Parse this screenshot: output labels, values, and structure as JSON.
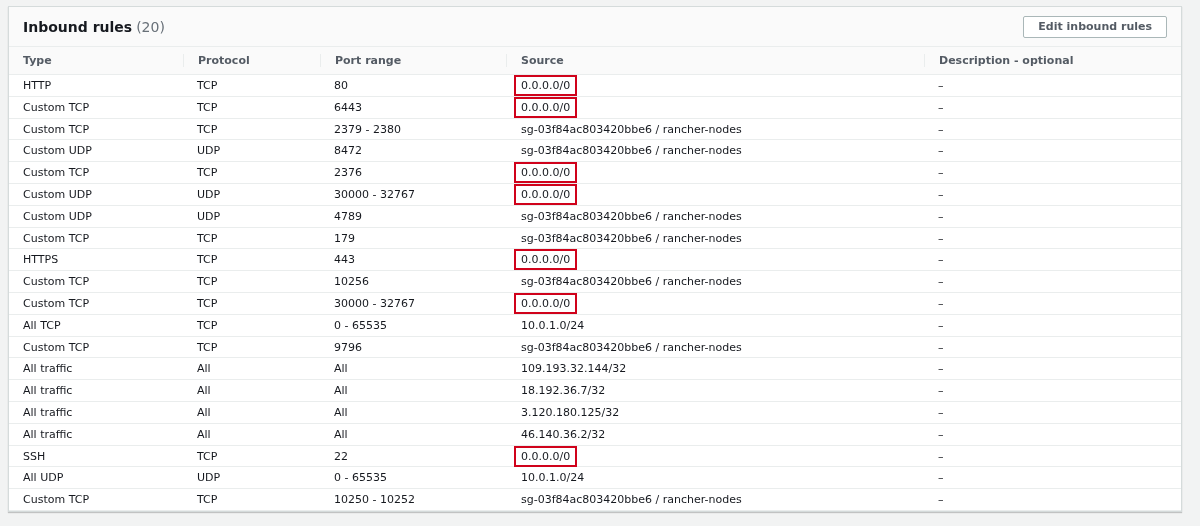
{
  "panel": {
    "title": "Inbound rules",
    "count": "(20)",
    "button": "Edit inbound rules"
  },
  "table": {
    "columns": [
      "Type",
      "Protocol",
      "Port range",
      "Source",
      "Description - optional"
    ],
    "rows": [
      {
        "cells": [
          "HTTP",
          "TCP",
          "80",
          "0.0.0.0/0",
          "–"
        ],
        "highlighted": true
      },
      {
        "cells": [
          "Custom TCP",
          "TCP",
          "6443",
          "0.0.0.0/0",
          "–"
        ],
        "highlighted": true
      },
      {
        "cells": [
          "Custom TCP",
          "TCP",
          "2379 - 2380",
          "sg-03f84ac803420bbe6 / rancher-nodes",
          "–"
        ],
        "highlighted": false
      },
      {
        "cells": [
          "Custom UDP",
          "UDP",
          "8472",
          "sg-03f84ac803420bbe6 / rancher-nodes",
          "–"
        ],
        "highlighted": false
      },
      {
        "cells": [
          "Custom TCP",
          "TCP",
          "2376",
          "0.0.0.0/0",
          "–"
        ],
        "highlighted": true
      },
      {
        "cells": [
          "Custom UDP",
          "UDP",
          "30000 - 32767",
          "0.0.0.0/0",
          "–"
        ],
        "highlighted": true
      },
      {
        "cells": [
          "Custom UDP",
          "UDP",
          "4789",
          "sg-03f84ac803420bbe6 / rancher-nodes",
          "–"
        ],
        "highlighted": false
      },
      {
        "cells": [
          "Custom TCP",
          "TCP",
          "179",
          "sg-03f84ac803420bbe6 / rancher-nodes",
          "–"
        ],
        "highlighted": false
      },
      {
        "cells": [
          "HTTPS",
          "TCP",
          "443",
          "0.0.0.0/0",
          "–"
        ],
        "highlighted": true
      },
      {
        "cells": [
          "Custom TCP",
          "TCP",
          "10256",
          "sg-03f84ac803420bbe6 / rancher-nodes",
          "–"
        ],
        "highlighted": false
      },
      {
        "cells": [
          "Custom TCP",
          "TCP",
          "30000 - 32767",
          "0.0.0.0/0",
          "–"
        ],
        "highlighted": true
      },
      {
        "cells": [
          "All TCP",
          "TCP",
          "0 - 65535",
          "10.0.1.0/24",
          "–"
        ],
        "highlighted": false
      },
      {
        "cells": [
          "Custom TCP",
          "TCP",
          "9796",
          "sg-03f84ac803420bbe6 / rancher-nodes",
          "–"
        ],
        "highlighted": false
      },
      {
        "cells": [
          "All traffic",
          "All",
          "All",
          "109.193.32.144/32",
          "–"
        ],
        "highlighted": false
      },
      {
        "cells": [
          "All traffic",
          "All",
          "All",
          "18.192.36.7/32",
          "–"
        ],
        "highlighted": false
      },
      {
        "cells": [
          "All traffic",
          "All",
          "All",
          "3.120.180.125/32",
          "–"
        ],
        "highlighted": false
      },
      {
        "cells": [
          "All traffic",
          "All",
          "All",
          "46.140.36.2/32",
          "–"
        ],
        "highlighted": false
      },
      {
        "cells": [
          "SSH",
          "TCP",
          "22",
          "0.0.0.0/0",
          "–"
        ],
        "highlighted": true
      },
      {
        "cells": [
          "All UDP",
          "UDP",
          "0 - 65535",
          "10.0.1.0/24",
          "–"
        ],
        "highlighted": false
      },
      {
        "cells": [
          "Custom TCP",
          "TCP",
          "10250 - 10252",
          "sg-03f84ac803420bbe6 / rancher-nodes",
          "–"
        ],
        "highlighted": false
      }
    ]
  }
}
